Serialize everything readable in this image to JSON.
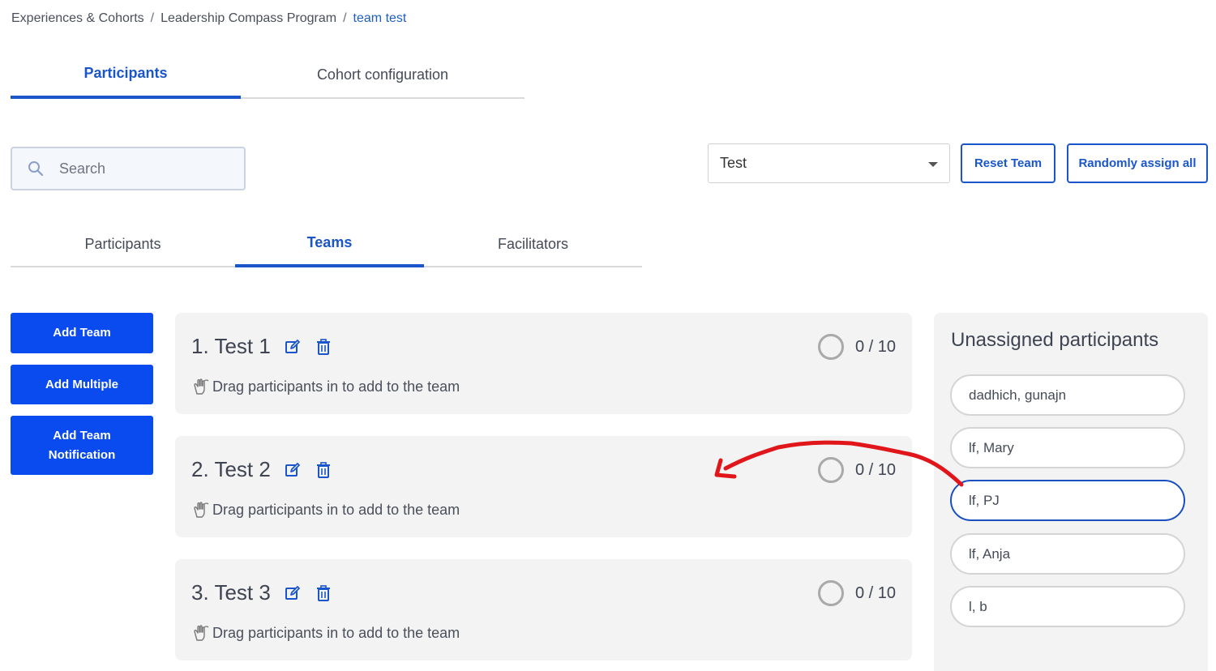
{
  "breadcrumb": {
    "items": [
      "Experiences & Cohorts",
      "Leadership Compass Program"
    ],
    "separator": "/",
    "current": "team test"
  },
  "top_tabs": [
    {
      "label": "Participants",
      "active": true
    },
    {
      "label": "Cohort configuration",
      "active": false
    }
  ],
  "search": {
    "placeholder": "Search",
    "value": ""
  },
  "team_select": {
    "value": "Test"
  },
  "buttons": {
    "reset_team": "Reset Team",
    "randomly_assign_all": "Randomly assign all",
    "add_team": "Add Team",
    "add_multiple": "Add Multiple",
    "add_team_notification": "Add Team Notification"
  },
  "sub_tabs": [
    {
      "label": "Participants",
      "active": false
    },
    {
      "label": "Teams",
      "active": true
    },
    {
      "label": "Facilitators",
      "active": false
    }
  ],
  "teams": [
    {
      "name": "1. Test 1",
      "count": "0 / 10",
      "hint": "Drag participants in to add to the team"
    },
    {
      "name": "2. Test 2",
      "count": "0 / 10",
      "hint": "Drag participants in to add to the team"
    },
    {
      "name": "3. Test 3",
      "count": "0 / 10",
      "hint": "Drag participants in to add to the team"
    }
  ],
  "unassigned": {
    "title": "Unassigned participants",
    "participants": [
      {
        "name": "dadhich, gunajn",
        "selected": false
      },
      {
        "name": "lf, Mary",
        "selected": false
      },
      {
        "name": "lf, PJ",
        "selected": true
      },
      {
        "name": "lf, Anja",
        "selected": false
      },
      {
        "name": "l, b",
        "selected": false
      }
    ]
  },
  "colors": {
    "accent": "#1a56c9",
    "primary_button": "#0a4bf0",
    "annotation_arrow": "#e0161b",
    "card_background": "#f3f3f3"
  },
  "icons": [
    "search-icon",
    "edit-icon",
    "trash-icon",
    "drag-hand-icon",
    "chevron-down-icon"
  ]
}
